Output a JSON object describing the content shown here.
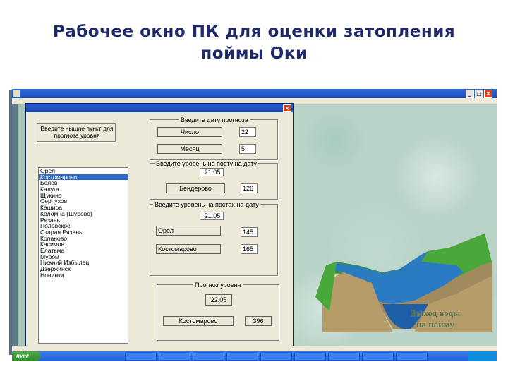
{
  "slide": {
    "title_line1": "Рабочее окно ПК для оценки затопления",
    "title_line2": "поймы Оки"
  },
  "dialog": {
    "list_label": "Введите нышле пункт для прогноза уровня",
    "date_group": "Введите дату прогноза",
    "day_label": "Число",
    "day_value": "22",
    "month_label": "Месяц",
    "month_value": "5",
    "level_group": "Введите уровень на посту на дату",
    "level_date": "21.05",
    "post_name": "Бендерово",
    "post_value": "126",
    "levels_group": "Введите уровень на постах на дату",
    "levels_date": "21.05",
    "post1_name": "Орел",
    "post1_value": "145",
    "post2_name": "Костомарово",
    "post2_value": "165",
    "forecast_group": "Прогноз уровня",
    "forecast_date": "22.05",
    "forecast_post": "Костомарово",
    "forecast_value": "396"
  },
  "river_posts": [
    "Орел",
    "Костомарово",
    "Белев",
    "Калуга",
    "Щукино",
    "Серпухов",
    "Каширa",
    "Коломна (Шурово)",
    "Рязань",
    "Половское",
    "Старая Рязань",
    "Копаново",
    "Касимов",
    "Елатьма",
    "Муром",
    "Нижний Избылец",
    "Дзержинск",
    "Новинки"
  ],
  "selected_post_index": 1,
  "image_caption": {
    "line1": "Выход воды",
    "line2": "на пойму"
  },
  "taskbar": {
    "start_label": "пуск"
  },
  "colors": {
    "title": "#1f2a6b",
    "water": "#2a7bc4",
    "grass": "#3c8f2e",
    "soil": "#a08a5e",
    "selection": "#316ac5"
  }
}
